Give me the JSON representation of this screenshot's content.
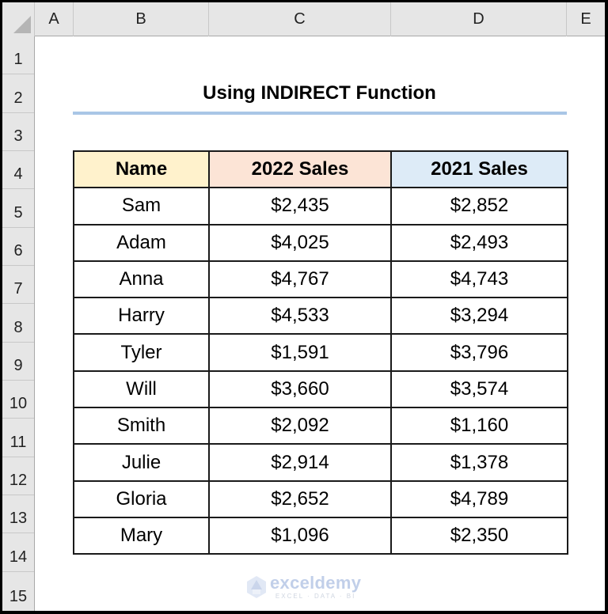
{
  "spreadsheet": {
    "columns": [
      "A",
      "B",
      "C",
      "D",
      "E"
    ],
    "rows": [
      "1",
      "2",
      "3",
      "4",
      "5",
      "6",
      "7",
      "8",
      "9",
      "10",
      "11",
      "12",
      "13",
      "14",
      "15"
    ],
    "title": "Using INDIRECT Function",
    "table": {
      "headers": [
        "Name",
        "2022 Sales",
        "2021 Sales"
      ],
      "header_colors": [
        "#fff2cc",
        "#fce4d6",
        "#ddebf7"
      ],
      "rows": [
        [
          "Sam",
          "$2,435",
          "$2,852"
        ],
        [
          "Adam",
          "$4,025",
          "$2,493"
        ],
        [
          "Anna",
          "$4,767",
          "$4,743"
        ],
        [
          "Harry",
          "$4,533",
          "$3,294"
        ],
        [
          "Tyler",
          "$1,591",
          "$3,796"
        ],
        [
          "Will",
          "$3,660",
          "$3,574"
        ],
        [
          "Smith",
          "$2,092",
          "$1,160"
        ],
        [
          "Julie",
          "$2,914",
          "$1,378"
        ],
        [
          "Gloria",
          "$2,652",
          "$4,789"
        ],
        [
          "Mary",
          "$1,096",
          "$2,350"
        ]
      ]
    },
    "title_underline_color": "#a9c6e6"
  },
  "watermark": {
    "name": "exceldemy",
    "tagline": "EXCEL · DATA · BI"
  }
}
